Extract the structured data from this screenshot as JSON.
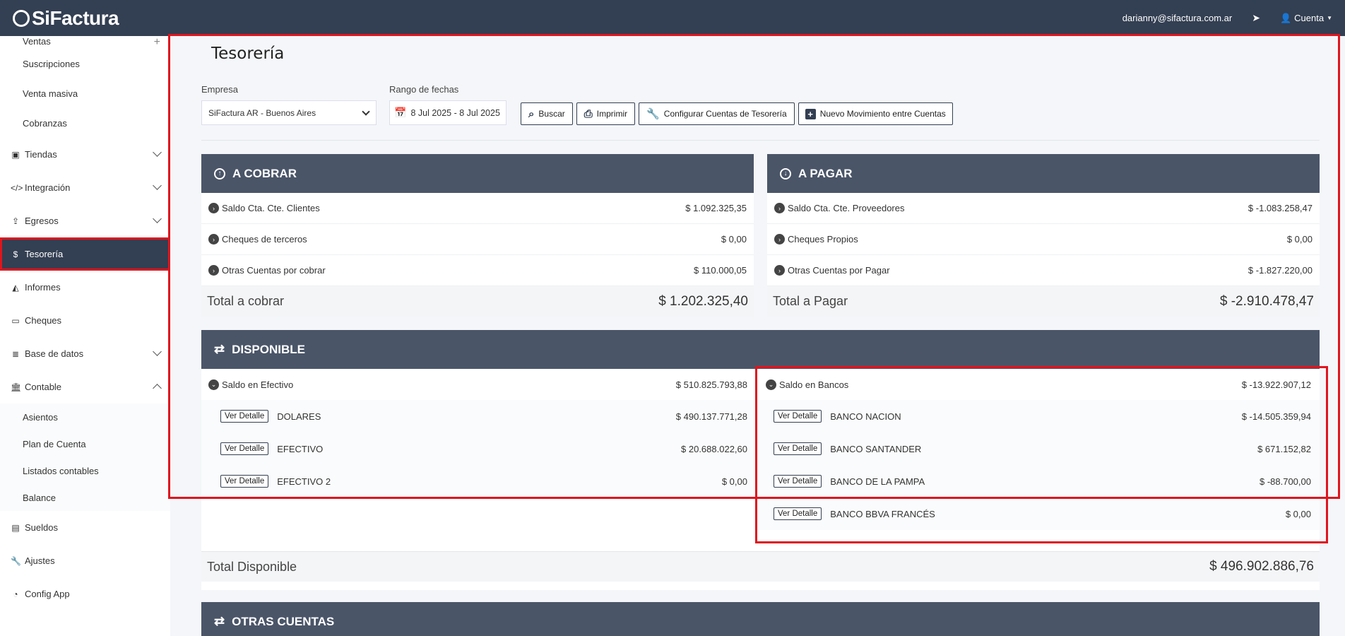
{
  "topbar": {
    "brand": "SiFactura",
    "email": "darianny@sifactura.com.ar",
    "account": "Cuenta"
  },
  "sidebar": {
    "ventas": "Ventas",
    "ventas_sub": [
      "Suscripciones",
      "Venta masiva",
      "Cobranzas"
    ],
    "tiendas": "Tiendas",
    "integracion": "Integración",
    "egresos": "Egresos",
    "tesoreria": "Tesorería",
    "informes": "Informes",
    "cheques": "Cheques",
    "base_datos": "Base de datos",
    "contable": "Contable",
    "contable_sub": [
      "Asientos",
      "Plan de Cuenta",
      "Listados contables",
      "Balance"
    ],
    "sueldos": "Sueldos",
    "ajustes": "Ajustes",
    "config_app": "Config App"
  },
  "page": {
    "title": "Tesorería"
  },
  "filters": {
    "empresa_label": "Empresa",
    "empresa_value": "SiFactura AR - Buenos Aires",
    "rango_label": "Rango de fechas",
    "rango_value": "8 Jul 2025 - 8 Jul 2025",
    "buscar": "Buscar",
    "imprimir": "Imprimir",
    "configurar": "Configurar Cuentas de Tesorería",
    "nuevo": "Nuevo Movimiento entre Cuentas"
  },
  "cobrar": {
    "title": "A COBRAR",
    "rows": [
      {
        "label": "Saldo Cta. Cte. Clientes",
        "value": "$ 1.092.325,35"
      },
      {
        "label": "Cheques de terceros",
        "value": "$ 0,00"
      },
      {
        "label": "Otras Cuentas por cobrar",
        "value": "$ 110.000,05"
      }
    ],
    "total_label": "Total a cobrar",
    "total_value": "$ 1.202.325,40"
  },
  "pagar": {
    "title": "A PAGAR",
    "rows": [
      {
        "label": "Saldo Cta. Cte. Proveedores",
        "value": "$ -1.083.258,47"
      },
      {
        "label": "Cheques Propios",
        "value": "$ 0,00"
      },
      {
        "label": "Otras Cuentas por Pagar",
        "value": "$ -1.827.220,00"
      }
    ],
    "total_label": "Total a Pagar",
    "total_value": "$ -2.910.478,47"
  },
  "disponible": {
    "title": "DISPONIBLE",
    "efectivo_label": "Saldo en Efectivo",
    "efectivo_value": "$ 510.825.793,88",
    "efectivo_rows": [
      {
        "detail": "Ver Detalle",
        "label": "DOLARES",
        "value": "$ 490.137.771,28"
      },
      {
        "detail": "Ver Detalle",
        "label": "EFECTIVO",
        "value": "$ 20.688.022,60"
      },
      {
        "detail": "Ver Detalle",
        "label": "EFECTIVO 2",
        "value": "$ 0,00"
      }
    ],
    "bancos_label": "Saldo en Bancos",
    "bancos_value": "$ -13.922.907,12",
    "bancos_rows": [
      {
        "detail": "Ver Detalle",
        "label": "BANCO NACION",
        "value": "$ -14.505.359,94"
      },
      {
        "detail": "Ver Detalle",
        "label": "BANCO SANTANDER",
        "value": "$ 671.152,82"
      },
      {
        "detail": "Ver Detalle",
        "label": "BANCO DE LA PAMPA",
        "value": "$ -88.700,00"
      },
      {
        "detail": "Ver Detalle",
        "label": "BANCO BBVA FRANCÉS",
        "value": "$ 0,00"
      }
    ],
    "total_label": "Total Disponible",
    "total_value": "$ 496.902.886,76"
  },
  "otras": {
    "title": "OTRAS CUENTAS"
  },
  "colors": {
    "header": "#333f52",
    "card_header": "#4a5568",
    "highlight": "#e0151e"
  }
}
